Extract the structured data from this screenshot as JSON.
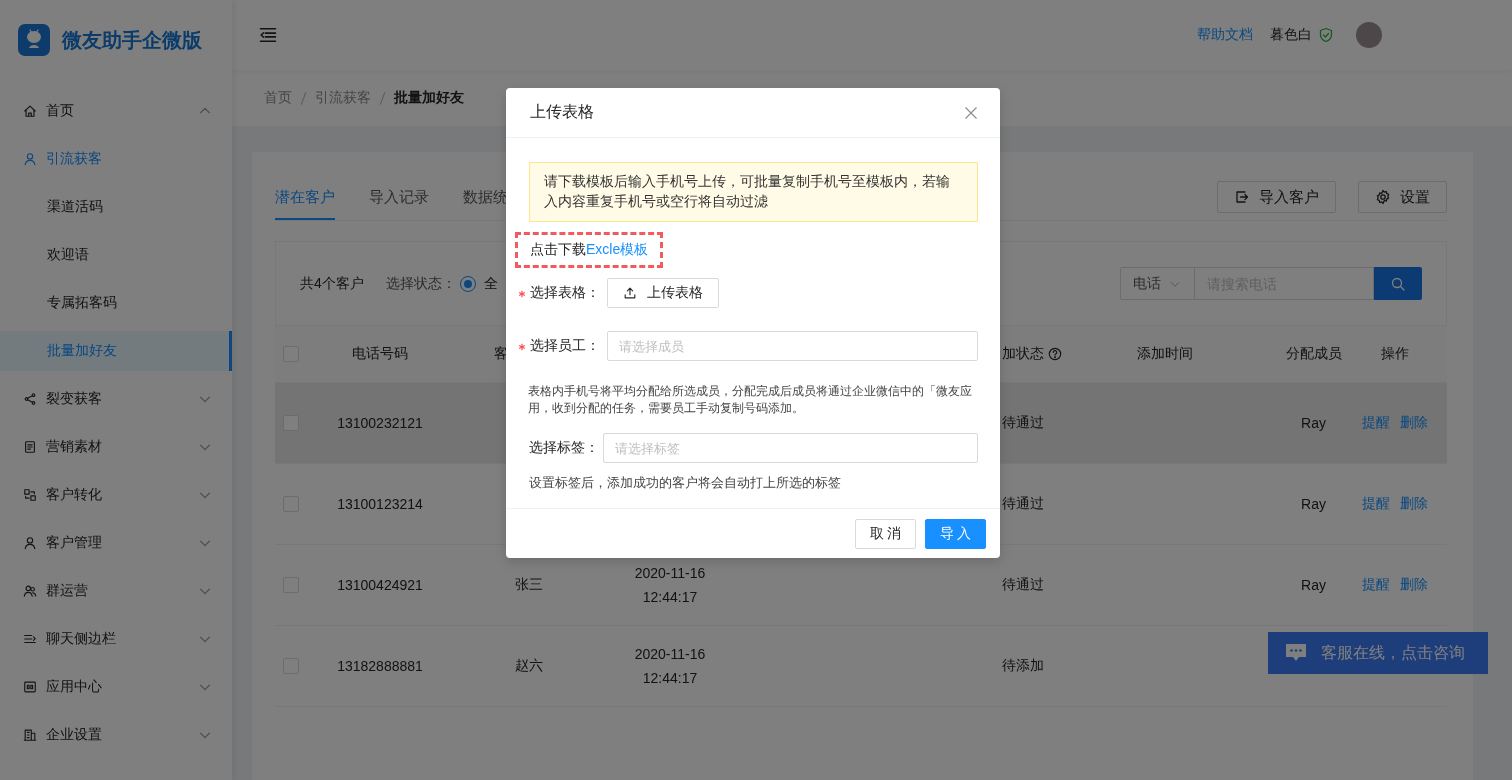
{
  "sidebar": {
    "app_name": "微友助手企微版",
    "items": [
      {
        "label": "首页",
        "selected": false,
        "expanded": true
      },
      {
        "label": "引流获客",
        "selected": true,
        "expanded": true,
        "children": [
          {
            "label": "渠道活码",
            "selected": false
          },
          {
            "label": "欢迎语",
            "selected": false
          },
          {
            "label": "专属拓客码",
            "selected": false
          },
          {
            "label": "批量加好友",
            "selected": true
          }
        ]
      },
      {
        "label": "裂变获客",
        "selected": false,
        "expanded": false
      },
      {
        "label": "营销素材",
        "selected": false,
        "expanded": false
      },
      {
        "label": "客户转化",
        "selected": false,
        "expanded": false
      },
      {
        "label": "客户管理",
        "selected": false,
        "expanded": false
      },
      {
        "label": "群运营",
        "selected": false,
        "expanded": false
      },
      {
        "label": "聊天侧边栏",
        "selected": false,
        "expanded": false
      },
      {
        "label": "应用中心",
        "selected": false,
        "expanded": false
      },
      {
        "label": "企业设置",
        "selected": false,
        "expanded": false
      }
    ]
  },
  "header": {
    "help_link": "帮助文档",
    "user_name": "暮色白"
  },
  "breadcrumb": [
    "首页",
    "引流获客",
    "批量加好友"
  ],
  "tabs": [
    {
      "label": "潜在客户",
      "selected": true
    },
    {
      "label": "导入记录",
      "selected": false
    },
    {
      "label": "数据统",
      "selected": false
    }
  ],
  "toolbar_buttons": [
    "导入客户",
    "设置"
  ],
  "filter": {
    "count": "共4个客户",
    "status_label": "选择状态：",
    "status_options": [
      {
        "label": "全",
        "selected": true
      }
    ],
    "search_field": "电话",
    "search_placeholder": "请搜索电话"
  },
  "table": {
    "header_checked": false,
    "columns": {
      "phone": "电话号码",
      "name": "客",
      "status": "加状态",
      "added": "添加时间",
      "member": "分配成员",
      "actions": "操作"
    },
    "rows": [
      {
        "checked": false,
        "hovered": true,
        "phone": "13100232121",
        "status": "待通过",
        "member": "Ray",
        "actions": [
          "提醒",
          "删除"
        ]
      },
      {
        "checked": false,
        "hovered": false,
        "phone": "13100123214",
        "status": "待通过",
        "member": "Ray",
        "actions": [
          "提醒",
          "删除"
        ]
      },
      {
        "checked": false,
        "hovered": false,
        "phone": "13100424921",
        "name": "张三",
        "created": "2020-11-16 12:44:17",
        "status": "待通过",
        "member": "Ray",
        "actions": [
          "提醒",
          "删除"
        ]
      },
      {
        "checked": false,
        "hovered": false,
        "phone": "13182888881",
        "name": "赵六",
        "created": "2020-11-16 12:44:17",
        "status": "待添加"
      }
    ]
  },
  "chat_widget": {
    "label": "客服在线，点击咨询"
  },
  "modal": {
    "title": "上传表格",
    "notice": "请下载模板后输入手机号上传，可批量复制手机号至模板内，若输入内容重复手机号或空行将自动过滤",
    "download_text": "点击下载",
    "download_link": "Excle模板",
    "download_highlighted": true,
    "fields": [
      {
        "kind": "upload",
        "label": "选择表格：",
        "required": true,
        "button": "上传表格"
      },
      {
        "kind": "select",
        "label": "选择员工：",
        "required": true,
        "placeholder": "请选择成员"
      },
      {
        "kind": "note",
        "text": "表格内手机号将平均分配给所选成员，分配完成后成员将通过企业微信中的「微友应用，收到分配的任务，需要员工手动复制号码添加。"
      },
      {
        "kind": "select",
        "label": "选择标签：",
        "required": false,
        "placeholder": "请选择标签"
      },
      {
        "kind": "hint",
        "text": "设置标签后，添加成功的客户将会自动打上所选的标签"
      }
    ],
    "buttons": [
      {
        "label": "取 消",
        "kind": "default"
      },
      {
        "label": "导 入",
        "kind": "primary"
      }
    ]
  }
}
